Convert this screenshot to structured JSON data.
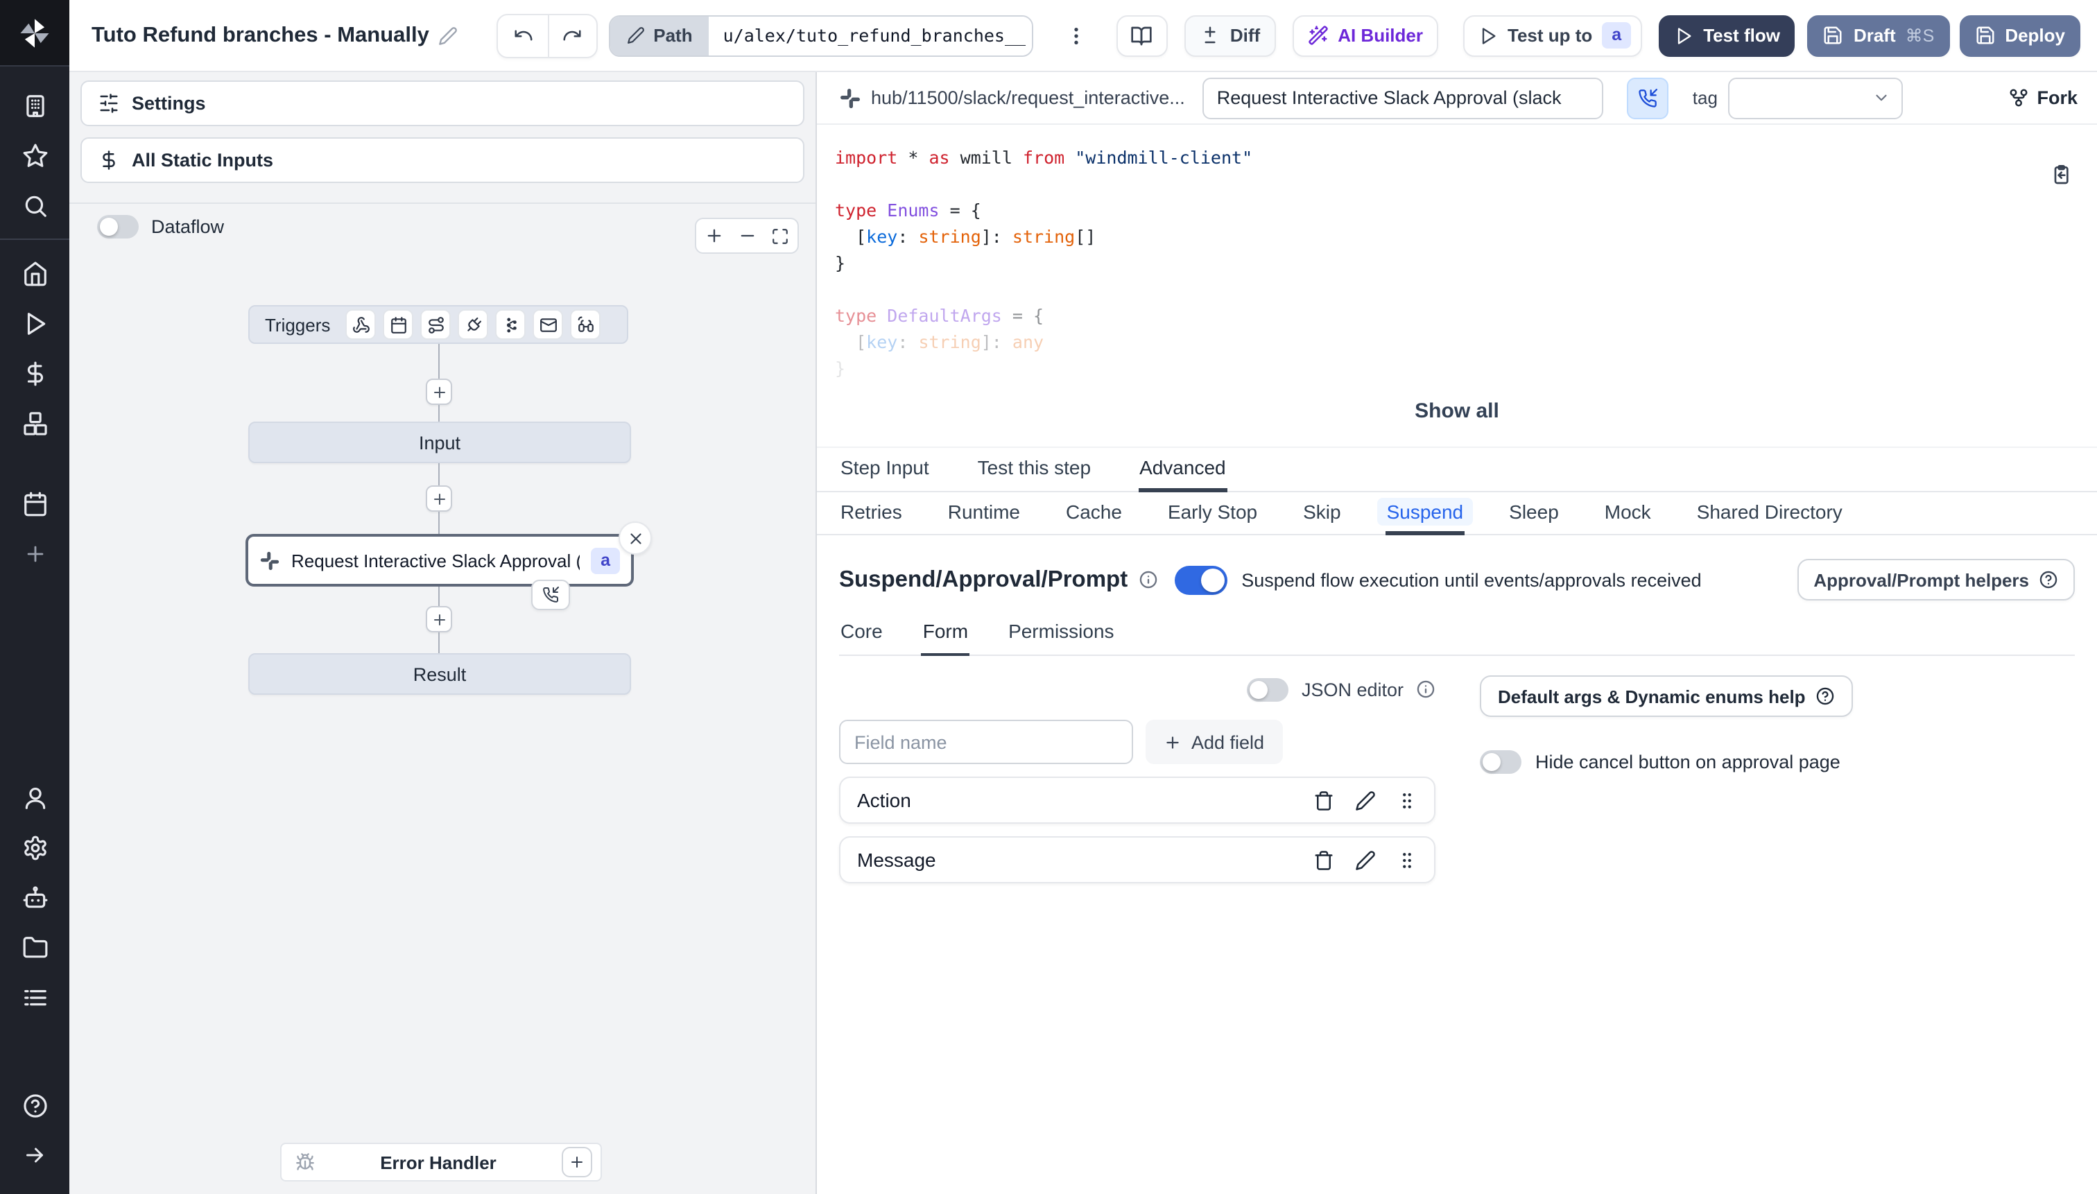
{
  "topbar": {
    "title": "Tuto Refund branches - Manually",
    "path_label": "Path",
    "path_value": "u/alex/tuto_refund_branches__",
    "diff_label": "Diff",
    "ai_builder_label": "AI Builder",
    "test_up_to_label": "Test up to",
    "test_up_to_badge": "a",
    "test_flow_label": "Test flow",
    "draft_label": "Draft",
    "draft_shortcut": "⌘S",
    "deploy_label": "Deploy"
  },
  "flow_panel": {
    "settings_label": "Settings",
    "static_inputs_label": "All Static Inputs",
    "dataflow_label": "Dataflow",
    "graph": {
      "triggers_label": "Triggers",
      "trigger_icons": [
        "webhook",
        "schedule",
        "http-route",
        "websocket",
        "kafka",
        "email",
        "scheduled-poll"
      ],
      "input_label": "Input",
      "step_label": "Request Interactive Slack Approval (...",
      "step_badge": "a",
      "result_label": "Result",
      "error_handler_label": "Error Handler"
    }
  },
  "right_panel": {
    "hub_path": "hub/11500/slack/request_interactive...",
    "summary_value": "Request Interactive Slack Approval (slack",
    "tag_label": "tag",
    "fork_label": "Fork",
    "show_all_label": "Show all",
    "code": {
      "lines": [
        {
          "op": 1,
          "segments": [
            {
              "t": "import",
              "c": "kw"
            },
            {
              "t": " * ",
              "c": "pl"
            },
            {
              "t": "as",
              "c": "kw"
            },
            {
              "t": " wmill ",
              "c": "pl"
            },
            {
              "t": "from",
              "c": "kw"
            },
            {
              "t": " ",
              "c": "pl"
            },
            {
              "t": "\"windmill-client\"",
              "c": "str"
            }
          ]
        },
        {
          "op": 1,
          "segments": []
        },
        {
          "op": 1,
          "segments": [
            {
              "t": "type",
              "c": "kw"
            },
            {
              "t": " ",
              "c": "pl"
            },
            {
              "t": "Enums",
              "c": "typ"
            },
            {
              "t": " = {",
              "c": "pl"
            }
          ]
        },
        {
          "op": 1,
          "segments": [
            {
              "t": "  [",
              "c": "pl"
            },
            {
              "t": "key",
              "c": "key"
            },
            {
              "t": ": ",
              "c": "pl"
            },
            {
              "t": "string",
              "c": "orn"
            },
            {
              "t": "]: ",
              "c": "pl"
            },
            {
              "t": "string",
              "c": "orn"
            },
            {
              "t": "[]",
              "c": "pl"
            }
          ]
        },
        {
          "op": 1,
          "segments": [
            {
              "t": "}",
              "c": "pl"
            }
          ]
        },
        {
          "op": 1,
          "segments": []
        },
        {
          "op": 0.5,
          "segments": [
            {
              "t": "type",
              "c": "kw"
            },
            {
              "t": " ",
              "c": "pl"
            },
            {
              "t": "DefaultArgs",
              "c": "typ"
            },
            {
              "t": " = {",
              "c": "pl"
            }
          ]
        },
        {
          "op": 0.3,
          "segments": [
            {
              "t": "  [",
              "c": "pl"
            },
            {
              "t": "key",
              "c": "key"
            },
            {
              "t": ": ",
              "c": "pl"
            },
            {
              "t": "string",
              "c": "orn"
            },
            {
              "t": "]: ",
              "c": "pl"
            },
            {
              "t": "any",
              "c": "orn"
            }
          ]
        },
        {
          "op": 0.12,
          "segments": [
            {
              "t": "}",
              "c": "pl"
            }
          ]
        }
      ]
    },
    "tabs": [
      "Step Input",
      "Test this step",
      "Advanced"
    ],
    "active_tab": "Advanced",
    "subtabs": [
      "Retries",
      "Runtime",
      "Cache",
      "Early Stop",
      "Skip",
      "Suspend",
      "Sleep",
      "Mock",
      "Shared Directory"
    ],
    "active_subtab": "Suspend",
    "suspend": {
      "title": "Suspend/Approval/Prompt",
      "toggle_caption": "Suspend flow execution until events/approvals received",
      "helpers_label": "Approval/Prompt helpers",
      "inner_tabs": [
        "Core",
        "Form",
        "Permissions"
      ],
      "active_inner_tab": "Form",
      "json_editor_label": "JSON editor",
      "field_placeholder": "Field name",
      "add_field_label": "Add field",
      "fields": [
        "Action",
        "Message"
      ],
      "default_args_help_label": "Default args & Dynamic enums help",
      "hide_cancel_label": "Hide cancel button on approval page"
    }
  },
  "colors": {
    "accent_blue": "#3069e2",
    "suspend_tab_blue": "#2563eb",
    "dark_button": "#343e59",
    "slate_button": "#64759b",
    "badge_bg": "#e0e7ff",
    "badge_text": "#4044c9",
    "sidebar_bg": "#1f222a"
  }
}
